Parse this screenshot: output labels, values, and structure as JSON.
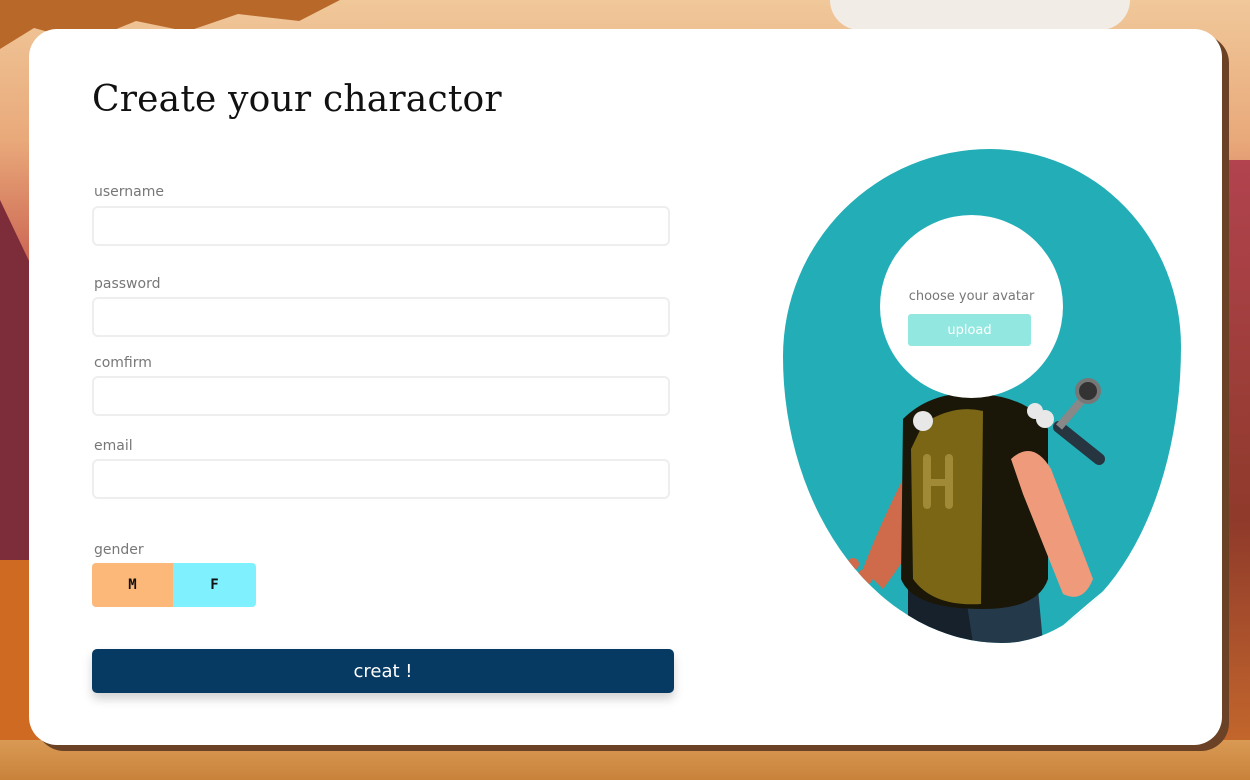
{
  "page": {
    "title": "Create your charactor"
  },
  "form": {
    "username_label": "username",
    "password_label": "password",
    "confirm_label": "comfirm",
    "email_label": "email",
    "gender_label": "gender",
    "gender_options": [
      "M",
      "F"
    ],
    "submit_label": "creat !"
  },
  "avatar": {
    "prompt": "choose your avatar",
    "upload_label": "upload"
  },
  "colors": {
    "submit_bg": "#063a62",
    "gender_m_bg": "#fbb878",
    "gender_f_bg": "#7ff0fd",
    "blob_bg": "#23adb6",
    "upload_bg": "#92e8e0"
  },
  "illustration": {
    "icon": "adventurer-character-illustration"
  }
}
